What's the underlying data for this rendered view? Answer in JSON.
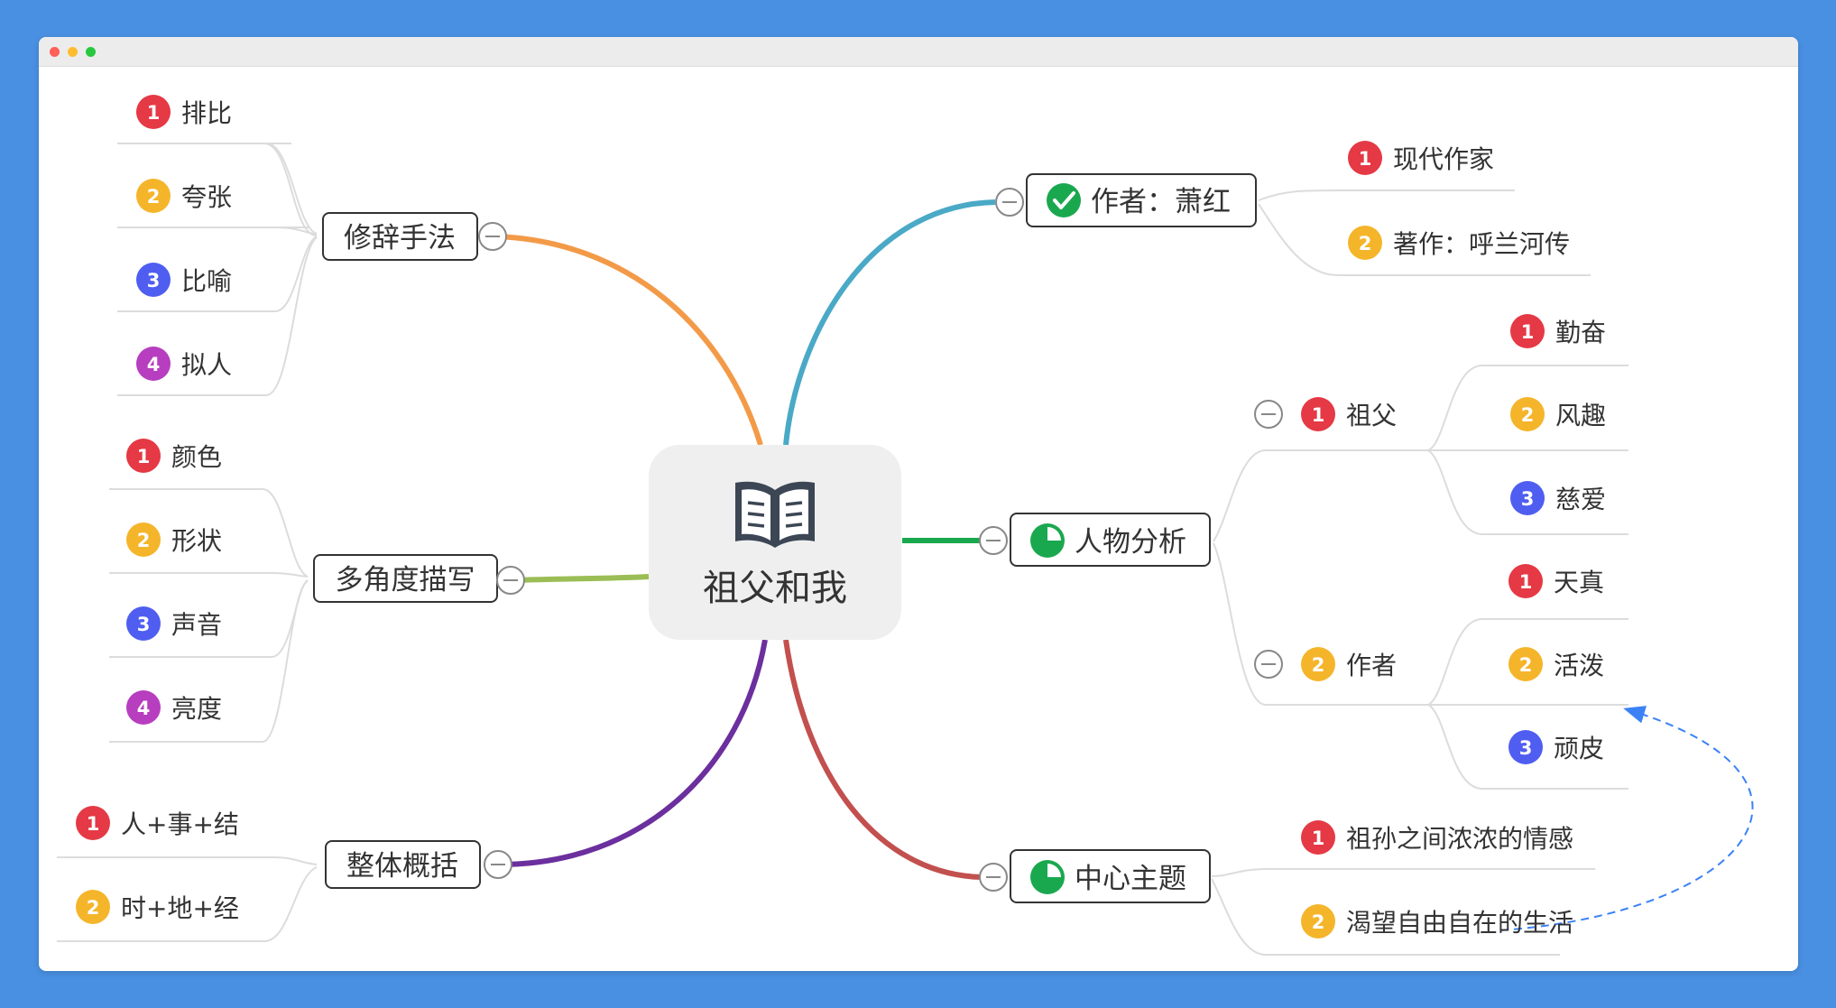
{
  "center": {
    "title": "祖父和我",
    "icon": "book-icon"
  },
  "window": {
    "controls": [
      "close",
      "minimize",
      "maximize"
    ]
  },
  "colors": {
    "badge1": "#e53945",
    "badge2": "#f5b52a",
    "badge3": "#4f5ef0",
    "badge4": "#b63ebf",
    "rhetoric": "#f39a48",
    "description": "#9bbd55",
    "summary": "#6b2f9e",
    "author": "#4aa9c6",
    "characters": "#1aa84f",
    "theme": "#c2504e",
    "relation": "#3b82f6"
  },
  "branches": {
    "rhetoric": {
      "label": "修辞手法",
      "items": [
        "排比",
        "夸张",
        "比喻",
        "拟人"
      ]
    },
    "description": {
      "label": "多角度描写",
      "items": [
        "颜色",
        "形状",
        "声音",
        "亮度"
      ]
    },
    "summary": {
      "label": "整体概括",
      "items": [
        "人+事+结",
        "时+地+经"
      ]
    },
    "author": {
      "label": "作者：萧红",
      "icon": "check-icon",
      "items": [
        "现代作家",
        "著作：呼兰河传"
      ]
    },
    "characters": {
      "label": "人物分析",
      "icon": "progress-pie-icon",
      "progress": 0.75,
      "grandfather": {
        "label": "祖父",
        "items": [
          "勤奋",
          "风趣",
          "慈爱"
        ]
      },
      "writer": {
        "label": "作者",
        "items": [
          "天真",
          "活泼",
          "顽皮"
        ]
      }
    },
    "theme": {
      "label": "中心主题",
      "icon": "progress-pie-icon",
      "progress": 0.75,
      "items": [
        "祖孙之间浓浓的情感",
        "渴望自由自在的生活"
      ]
    }
  }
}
